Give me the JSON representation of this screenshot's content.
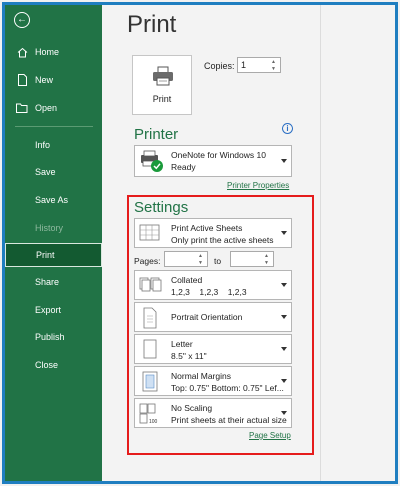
{
  "sidebar": {
    "items": [
      {
        "label": "Home",
        "icon": "home-icon"
      },
      {
        "label": "New",
        "icon": "new-document-icon"
      },
      {
        "label": "Open",
        "icon": "open-folder-icon"
      },
      {
        "label": "Info"
      },
      {
        "label": "Save"
      },
      {
        "label": "Save As"
      },
      {
        "label": "History"
      },
      {
        "label": "Print"
      },
      {
        "label": "Share"
      },
      {
        "label": "Export"
      },
      {
        "label": "Publish"
      },
      {
        "label": "Close"
      }
    ]
  },
  "main": {
    "title": "Print",
    "print_button_label": "Print",
    "copies_label": "Copies:",
    "copies_value": "1",
    "printer": {
      "heading": "Printer",
      "name": "OneNote for Windows 10",
      "status": "Ready",
      "properties_link": "Printer Properties"
    },
    "settings": {
      "heading": "Settings",
      "scope": {
        "line1": "Print Active Sheets",
        "line2": "Only print the active sheets"
      },
      "pages_label": "Pages:",
      "to_label": "to",
      "pages_from": "",
      "pages_to": "",
      "collation": {
        "line1": "Collated",
        "line2": "1,2,3    1,2,3    1,2,3"
      },
      "orientation": {
        "line1": "Portrait Orientation"
      },
      "paper": {
        "line1": "Letter",
        "line2": "8.5\" x 11\""
      },
      "margins": {
        "line1": "Normal Margins",
        "line2": "Top: 0.75\" Bottom: 0.75\" Lef..."
      },
      "scaling": {
        "line1": "No Scaling",
        "line2": "Print sheets at their actual size"
      },
      "page_setup_link": "Page Setup"
    }
  },
  "colors": {
    "sidebar_green": "#217346",
    "accent_green": "#217346",
    "highlight_red": "#e51b1b",
    "frame_blue": "#1f7ec0"
  }
}
